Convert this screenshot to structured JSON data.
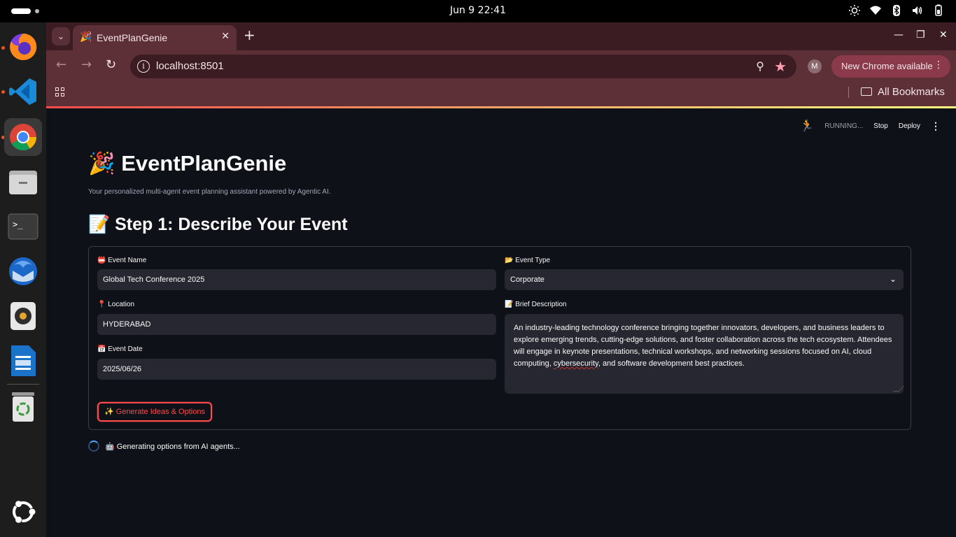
{
  "os": {
    "clock": "Jun 9  22:41",
    "tray_icons": [
      "brightness-icon",
      "wifi-icon",
      "bluetooth-icon",
      "volume-icon",
      "battery-icon"
    ],
    "dock": [
      "firefox",
      "vscode",
      "chrome",
      "files",
      "terminal",
      "thunderbird",
      "rhythmbox",
      "libreoffice-writer",
      "trash",
      "show-apps"
    ]
  },
  "browser": {
    "tab_title": "EventPlanGenie",
    "tab_icon": "🎉",
    "url": "localhost:8501",
    "profile_initial": "M",
    "update_label": "New Chrome available",
    "bookmarks_label": "All Bookmarks"
  },
  "streamlit": {
    "status": "RUNNING...",
    "stop_label": "Stop",
    "deploy_label": "Deploy",
    "menu_glyph": "⋮"
  },
  "app": {
    "title_emoji": "🎉",
    "title": "EventPlanGenie",
    "subtitle": "Your personalized multi-agent event planning assistant powered by Agentic AI.",
    "step1_title": "📝 Step 1: Describe Your Event"
  },
  "form": {
    "event_name_label": "📛 Event Name",
    "event_name_value": "Global Tech Conference 2025",
    "event_type_label": "📂 Event Type",
    "event_type_value": "Corporate",
    "location_label": "📍 Location",
    "location_value": "HYDERABAD",
    "description_label": "📝 Brief Description",
    "description_before": "An industry-leading technology conference bringing together innovators, developers, and business leaders to explore emerging trends, cutting-edge solutions, and foster collaboration across the tech ecosystem. Attendees will engage in keynote presentations, technical workshops, and networking sessions focused on AI, cloud computing, ",
    "description_misspelled": "cybersecurity",
    "description_after": ", and software development best practices.",
    "event_date_label": "📅 Event Date",
    "event_date_value": "2025/06/26",
    "generate_button": "✨ Generate Ideas & Options"
  },
  "spinner_text": "🤖 Generating options from AI agents...",
  "colors": {
    "page_bg": "#0e1117",
    "input_bg": "#262730",
    "accent": "#ff4b4b",
    "chrome_frame": "#3b1c22",
    "chrome_toolbar": "#5d2f37"
  }
}
